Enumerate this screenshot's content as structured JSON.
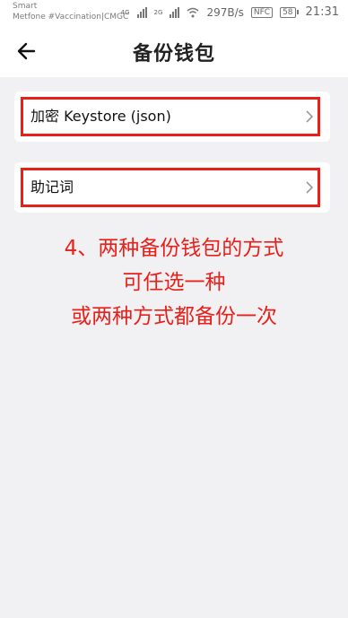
{
  "status_bar": {
    "carrier_line1": "Smart",
    "carrier_line2": "Metfone #Vaccination|CMGC",
    "network_4g": "4G",
    "network_2g": "2G",
    "speed": "297B/s",
    "nfc": "NFC",
    "battery": "58",
    "time": "21:31"
  },
  "header": {
    "title": "备份钱包"
  },
  "options": [
    {
      "label": "加密 Keystore (json)"
    },
    {
      "label": "助记词"
    }
  ],
  "annotation": {
    "line1": "4、两种备份钱包的方式",
    "line2": "可任选一种",
    "line3": "或两种方式都备份一次"
  },
  "colors": {
    "accent_red": "#e8201a",
    "background": "#f1f1f3"
  }
}
